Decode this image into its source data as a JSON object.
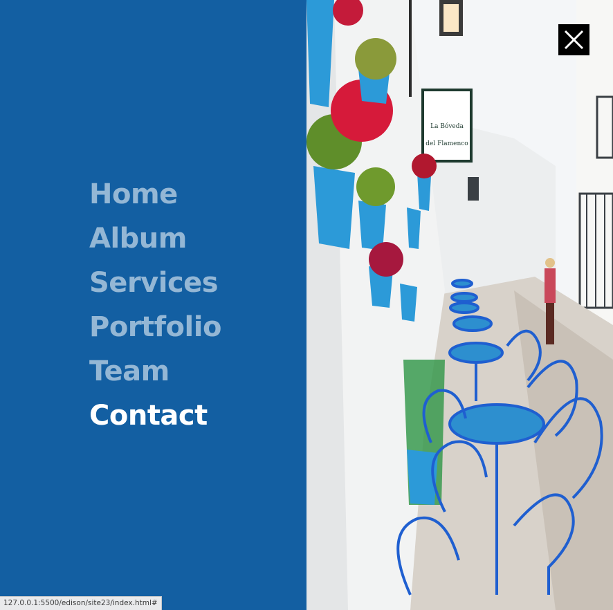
{
  "menu": {
    "items": [
      {
        "label": "Home"
      },
      {
        "label": "Album"
      },
      {
        "label": "Services"
      },
      {
        "label": "Portfolio"
      },
      {
        "label": "Team"
      },
      {
        "label": "Contact"
      }
    ],
    "active_item": "Contact"
  },
  "photo": {
    "sign_line1": "La Bóveda",
    "sign_line2": "del Flamenco"
  },
  "close": {
    "icon": "close-icon"
  },
  "status_bar": {
    "url": "127.0.0.1:5500/edison/site23/index.html#"
  },
  "colors": {
    "panel_bg": "#135fa2",
    "inactive_text": "#8fb1d3",
    "active_text": "#ffffff",
    "close_bg": "#000000"
  }
}
